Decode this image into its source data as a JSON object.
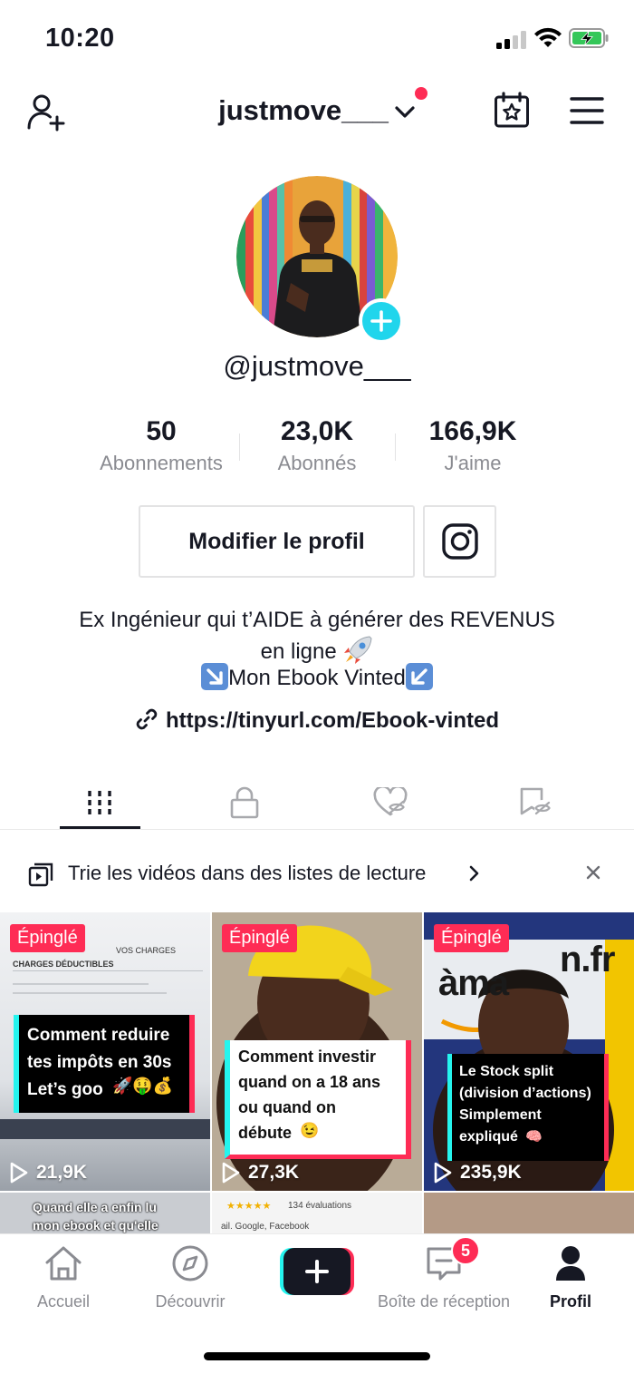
{
  "status_bar": {
    "time": "10:20"
  },
  "header": {
    "username": "justmove___"
  },
  "profile": {
    "handle": "@justmove___"
  },
  "stats": [
    {
      "value": "50",
      "label": "Abonnements"
    },
    {
      "value": "23,0K",
      "label": "Abonnés"
    },
    {
      "value": "166,9K",
      "label": "J'aime"
    }
  ],
  "buttons": {
    "edit_profile": "Modifier le profil"
  },
  "bio": {
    "line1": "Ex Ingénieur qui t’AIDE à générer des REVENUS",
    "line2": "en ligne",
    "line3": "Mon Ebook Vinted",
    "link": "https://tinyurl.com/Ebook-vinted"
  },
  "tabs": [
    {
      "name": "videos-grid",
      "icon": "grid-bars-icon",
      "active": true
    },
    {
      "name": "private",
      "icon": "lock-icon",
      "active": false
    },
    {
      "name": "liked",
      "icon": "heart-hidden-icon",
      "active": false
    },
    {
      "name": "favorites",
      "icon": "bookmark-hidden-icon",
      "active": false
    }
  ],
  "playlist_banner": {
    "text": "Trie les vidéos dans des listes de lecture"
  },
  "videos": [
    {
      "badge": "Épinglé",
      "caption": [
        "Comment reduire",
        "tes impôts en 30s",
        "Let’s goo"
      ],
      "views": "21,9K",
      "overlay": [
        "VOS CHARGES",
        "CHARGES DÉDUCTIBLES"
      ]
    },
    {
      "badge": "Épinglé",
      "caption": [
        "Comment investir",
        "quand on a 18 ans",
        "ou quand on",
        "débute"
      ],
      "views": "27,3K"
    },
    {
      "badge": "Épinglé",
      "caption": [
        "Le Stock split",
        "(division d’actions)",
        "Simplement",
        "expliqué"
      ],
      "views": "235,9K",
      "overlay": [
        "àma",
        "n.fr"
      ]
    },
    {
      "caption": [
        "Quand elle a enfin lu",
        "mon ebook et qu'elle"
      ]
    },
    {
      "caption": [
        "134 évaluations",
        "ail. Google, Facebook"
      ]
    },
    {
      "caption": []
    }
  ],
  "bottom_nav": [
    {
      "label": "Accueil",
      "icon": "home-icon"
    },
    {
      "label": "Découvrir",
      "icon": "compass-icon"
    },
    {
      "label": "",
      "icon": "create-plus-icon"
    },
    {
      "label": "Boîte de réception",
      "icon": "inbox-icon",
      "badge": "5"
    },
    {
      "label": "Profil",
      "icon": "profile-icon",
      "active": true
    }
  ],
  "colors": {
    "accent": "#fe2c55",
    "cyan": "#20d5ec",
    "text": "#161823",
    "muted": "#8a8b91"
  }
}
